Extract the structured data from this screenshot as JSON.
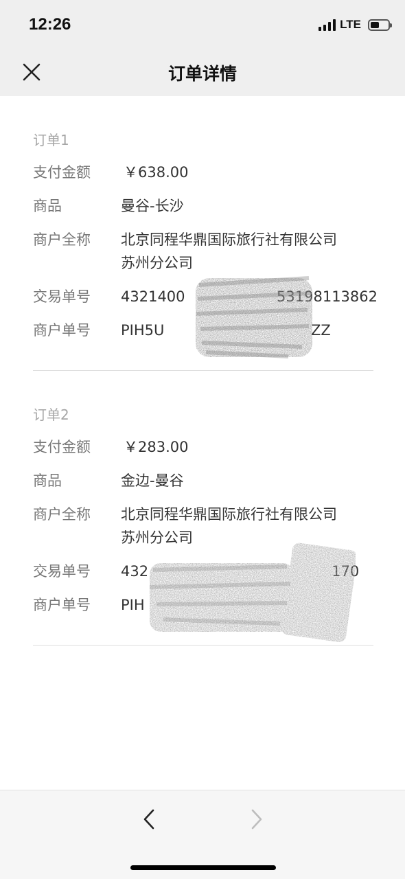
{
  "status_bar": {
    "time": "12:26",
    "network": "LTE",
    "signal_bars": 4,
    "battery_level": 0.4
  },
  "nav": {
    "title": "订单详情",
    "close_icon": "close-icon"
  },
  "orders": [
    {
      "title": "订单1",
      "fields": [
        {
          "label": "支付金额",
          "value": "￥638.00"
        },
        {
          "label": "商品",
          "value": "曼谷-长沙"
        },
        {
          "label": "商户全称",
          "value": "北京同程华鼎国际旅行社有限公司\n苏州分公司"
        },
        {
          "label": "交易单号",
          "value": "4321400                    53198113862"
        },
        {
          "label": "商户单号",
          "value": "PIH5U                                ZZ"
        }
      ]
    },
    {
      "title": "订单2",
      "fields": [
        {
          "label": "支付金额",
          "value": "￥283.00"
        },
        {
          "label": "商品",
          "value": "金边-曼谷"
        },
        {
          "label": "商户全称",
          "value": "北京同程华鼎国际旅行社有限公司\n苏州分公司"
        },
        {
          "label": "交易单号",
          "value": "432                                        170"
        },
        {
          "label": "商户单号",
          "value": "PIH"
        }
      ]
    }
  ],
  "toolbar": {
    "back_icon": "chevron-left-icon",
    "forward_icon": "chevron-right-icon"
  },
  "colors": {
    "bar_background": "#efefef",
    "label_gray": "#777777",
    "order_title_gray": "#a6a6a6",
    "divider": "#dedede"
  }
}
